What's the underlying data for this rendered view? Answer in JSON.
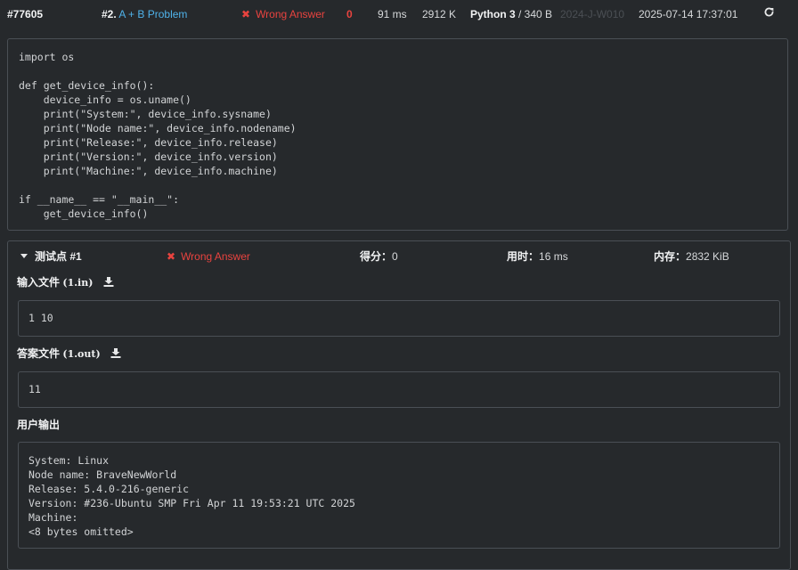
{
  "submission": {
    "id": "#77605",
    "problem_num": "#2.",
    "problem_title": "A + B Problem",
    "status": "Wrong Answer",
    "score": "0",
    "time": "91 ms",
    "memory": "2912 K",
    "language": "Python 3",
    "code_size": "/ 340 B",
    "contest": "2024-J-W010",
    "submitted_at": "2025-07-14 17:37:01",
    "refresh_icon": "refresh-icon"
  },
  "source_code": "import os\n\ndef get_device_info():\n    device_info = os.uname()\n    print(\"System:\", device_info.sysname)\n    print(\"Node name:\", device_info.nodename)\n    print(\"Release:\", device_info.release)\n    print(\"Version:\", device_info.version)\n    print(\"Machine:\", device_info.machine)\n\nif __name__ == \"__main__\":\n    get_device_info()",
  "testcase": {
    "title": "测试点 #1",
    "status": "Wrong Answer",
    "score_label": "得分：",
    "score_value": "0",
    "time_label": "用时：",
    "time_value": "16 ms",
    "memory_label": "内存：",
    "memory_value": "2832 KiB",
    "input_label": "输入文件",
    "input_file": "(1.in)",
    "input_content": "1 10",
    "answer_label": "答案文件",
    "answer_file": "(1.out)",
    "answer_content": "11",
    "output_label": "用户输出",
    "output_content": "System: Linux\nNode name: BraveNewWorld\nRelease: 5.4.0-216-generic\nVersion: #236-Ubuntu SMP Fri Apr 11 19:53:21 UTC 2025\nMachine:\n<8 bytes omitted>"
  },
  "colors": {
    "background": "#26292c",
    "border": "#4a4f55",
    "link": "#4fb2ea",
    "error": "#e8433f"
  }
}
